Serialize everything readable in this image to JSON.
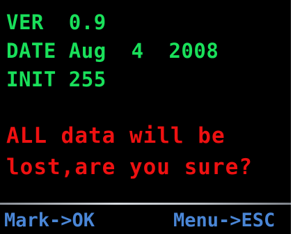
{
  "screen": {
    "version_line": "VER  0.9",
    "date_line": "DATE Aug  4  2008",
    "init_line": "INIT 255",
    "warning_line1": "ALL data will be",
    "warning_line2": "lost,are you sure?"
  },
  "softkeys": {
    "left_label": "Mark->OK",
    "right_label": "Menu->ESC"
  },
  "colors": {
    "background": "#000000",
    "info_text": "#19e05a",
    "warning_text": "#ee1111",
    "softkey_text": "#4a86d6"
  }
}
